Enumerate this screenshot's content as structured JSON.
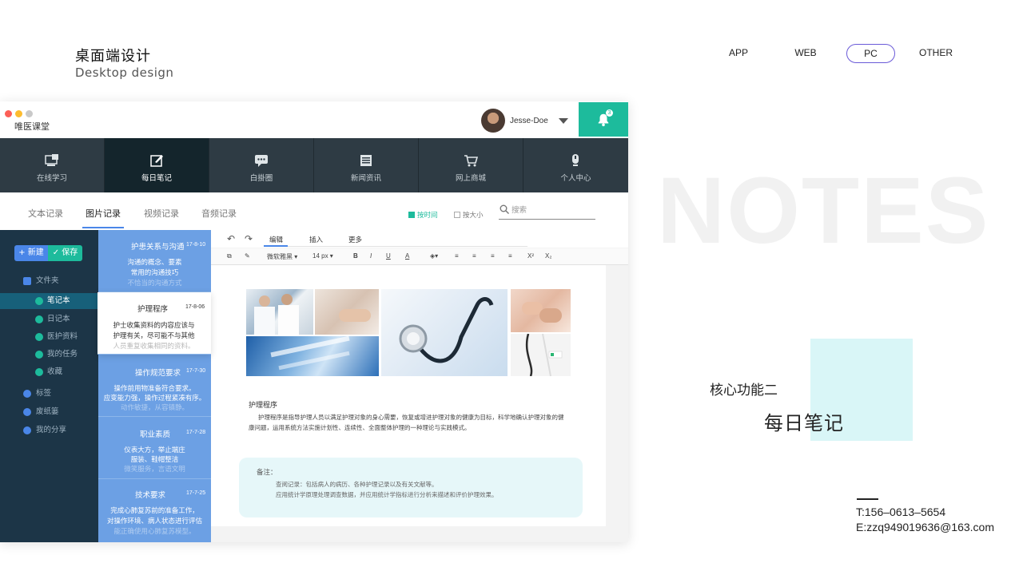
{
  "header": {
    "title": "桌面端设计",
    "subtitle": "Desktop design",
    "nav": [
      {
        "label": "APP",
        "active": false
      },
      {
        "label": "WEB",
        "active": false
      },
      {
        "label": "PC",
        "active": true
      },
      {
        "label": "OTHER",
        "active": false
      }
    ]
  },
  "showcase": {
    "bg_word": "NOTES",
    "feature_label": "核心功能二",
    "feature_title": "每日笔记",
    "phone": "T:156–0613–5654",
    "email": "E:zzq949019636@163.com"
  },
  "colors": {
    "accent_teal": "#1dbb9c",
    "accent_blue": "#4a86e8",
    "nav_dark": "#2e3b44",
    "sidebar": "#1c3547",
    "note_list": "#6ca0e4"
  },
  "app": {
    "name": "唯医课堂",
    "user": {
      "name": "Jesse-Doe",
      "avatar_icon": "user-avatar"
    },
    "notifications": {
      "count": "3",
      "icon": "bell-icon"
    },
    "main_nav": [
      {
        "label": "在线学习",
        "icon": "online-learning-icon",
        "active": false
      },
      {
        "label": "每日笔记",
        "icon": "daily-note-icon",
        "active": true
      },
      {
        "label": "白掛圈",
        "icon": "chat-icon",
        "active": false
      },
      {
        "label": "新闻资讯",
        "icon": "news-icon",
        "active": false
      },
      {
        "label": "网上商城",
        "icon": "cart-icon",
        "active": false
      },
      {
        "label": "个人中心",
        "icon": "profile-icon",
        "active": false
      }
    ],
    "sub_tabs": [
      {
        "label": "文本记录",
        "active": false
      },
      {
        "label": "图片记录",
        "active": true
      },
      {
        "label": "视频记录",
        "active": false
      },
      {
        "label": "音频记录",
        "active": false
      }
    ],
    "sort": [
      {
        "label": "按时间",
        "checked": true
      },
      {
        "label": "按大小",
        "checked": false
      }
    ],
    "search": {
      "placeholder": "搜索"
    },
    "sidebar": {
      "new_label": "新建",
      "save_label": "保存",
      "folder": "文件夹",
      "folder_items": [
        {
          "label": "笔记本",
          "active": true
        },
        {
          "label": "日记本",
          "active": false
        },
        {
          "label": "医护资料",
          "active": false
        },
        {
          "label": "我的任务",
          "active": false
        },
        {
          "label": "收藏",
          "active": false
        }
      ],
      "bottom_items": [
        {
          "label": "标签"
        },
        {
          "label": "废纸篓"
        },
        {
          "label": "我的分享"
        }
      ]
    },
    "notes": [
      {
        "title": "护患关系与沟通",
        "date": "17-8-10",
        "lines": [
          "沟通的概念、要素",
          "常用的沟通技巧",
          "不恰当的沟通方式"
        ]
      },
      {
        "title": "护理程序",
        "date": "17-8-06",
        "lines": [
          "护士收集资料的内容应该与",
          "护理有关，尽可能不与其他",
          "人员重复收集相同的资料。"
        ]
      },
      {
        "title": "操作规范要求",
        "date": "17-7-30",
        "lines": [
          "操作前用物准备符合要求。",
          "应变能力强，操作过程紧凑有序。",
          "动作敏捷，从容镇静。"
        ]
      },
      {
        "title": "职业素质",
        "date": "17-7-28",
        "lines": [
          "仪表大方，举止端庄",
          "服装、鞋帽整洁",
          "微笑服务，言语文明"
        ]
      },
      {
        "title": "技术要求",
        "date": "17-7-25",
        "lines": [
          "完成心肺复苏前的准备工作，",
          "对操作环境、病人状态进行评估",
          "能正确使用心肺复苏模型。"
        ]
      }
    ],
    "editor": {
      "tabs": [
        {
          "label": "编辑",
          "active": true
        },
        {
          "label": "插入",
          "active": false
        },
        {
          "label": "更多",
          "active": false
        }
      ],
      "font": "微软雅黑",
      "size": "14 px",
      "toolbar": [
        "B",
        "I",
        "U",
        "A",
        "X²",
        "X₂"
      ],
      "doc_heading": "护理程序",
      "doc_body": "护理程序是指导护理人员以满足护理对象的身心需要，恢复或增进护理对象的健康为目标，科学地确认护理对象的健康问题，运用系统方法实施计划性、连续性、全面整体护理的一种理论与实践模式。",
      "remark_label": "备注：",
      "remark_lines": [
        "查阅记录：包括病人的病历、各种护理记录以及有关文献等。",
        "应用统计学原理处理调查数据，并应用统计学指标进行分析来描述和评价护理效果。"
      ]
    }
  }
}
